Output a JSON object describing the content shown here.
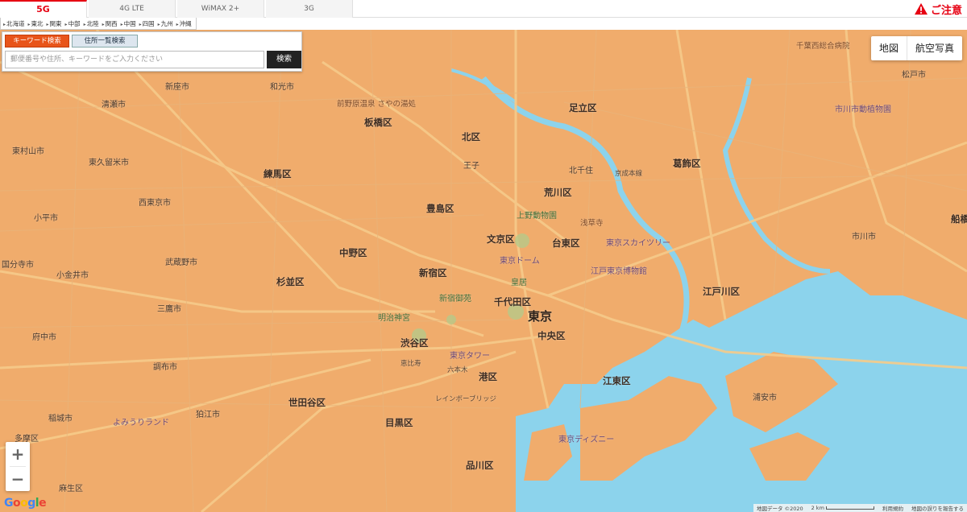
{
  "tabs": [
    {
      "label": "5G",
      "active": true
    },
    {
      "label": "4G LTE",
      "active": false
    },
    {
      "label": "WiMAX 2+",
      "active": false
    },
    {
      "label": "3G",
      "active": false
    }
  ],
  "caution": {
    "label": "ご注意",
    "icon": "warning-icon"
  },
  "regions": [
    "北海道",
    "東北",
    "関東",
    "中部",
    "北陸",
    "関西",
    "中国",
    "四国",
    "九州",
    "沖縄"
  ],
  "search": {
    "tab_keyword": "キーワード検索",
    "tab_address": "住所一覧検索",
    "placeholder": "郵便番号や住所、キーワードをご入力ください",
    "value": "",
    "button": "検索"
  },
  "map_type": {
    "map": "地図",
    "satellite": "航空写真"
  },
  "zoom": {
    "in": "+",
    "out": "−"
  },
  "attribution": {
    "data": "地図データ ©2020",
    "scale": "2 km",
    "terms": "利用規約",
    "report": "地図の誤りを報告する"
  },
  "colors": {
    "coverage": "#f0ac6c",
    "water": "#8cd3ec",
    "accent": "#e60012",
    "road": "#f4c27c"
  },
  "labels": {
    "wards": [
      "北区",
      "板橋区",
      "練馬区",
      "豊島区",
      "荒川区",
      "足立区",
      "葛飾区",
      "文京区",
      "台東区",
      "中野区",
      "新宿区",
      "杉並区",
      "千代田区",
      "中央区",
      "港区",
      "江東区",
      "江戸川区",
      "渋谷区",
      "世田谷区",
      "目黒区",
      "品川区"
    ],
    "tokyo": "東京",
    "cities": [
      "新座市",
      "和光市",
      "清瀬市",
      "東久留米市",
      "西東京市",
      "小平市",
      "武蔵野市",
      "三鷹市",
      "調布市",
      "狛江市",
      "稲城市",
      "府中市",
      "国分寺市",
      "小金井市",
      "東村山市",
      "松戸市",
      "市川市",
      "浦安市",
      "船橋",
      "麻生区",
      "多摩区"
    ],
    "places": [
      "前野原温泉 さやの湯処",
      "東京スカイツリー",
      "東京タワー",
      "東京ドーム",
      "浅草寺",
      "明治神宮",
      "新宿御苑",
      "皇居",
      "上野動物園",
      "よみうりランド",
      "東京ディズニー",
      "レインボーブリッジ",
      "千葉西総合病院",
      "市川市動植物園",
      "江戸東京博物館",
      "王子",
      "北千住",
      "六本木",
      "恵比寿",
      "京成本線"
    ]
  }
}
